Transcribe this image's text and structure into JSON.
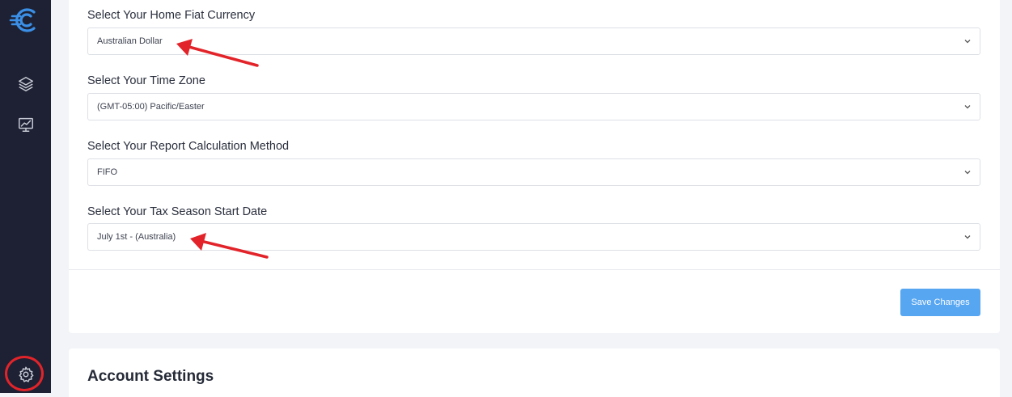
{
  "sidebar": {
    "icons": [
      "logo-icon",
      "layers-icon",
      "chart-icon",
      "gear-icon"
    ]
  },
  "settings": {
    "currency": {
      "label": "Select Your Home Fiat Currency",
      "value": "Australian Dollar"
    },
    "timezone": {
      "label": "Select Your Time Zone",
      "value": "(GMT-05:00) Pacific/Easter"
    },
    "method": {
      "label": "Select Your Report Calculation Method",
      "value": "FIFO"
    },
    "tax_start": {
      "label": "Select Your Tax Season Start Date",
      "value": "July 1st - (Australia)"
    },
    "save_label": "Save Changes"
  },
  "account": {
    "title": "Account Settings"
  },
  "colors": {
    "sidebar": "#1d2133",
    "accent": "#57a6f2",
    "annotation": "#e2242a",
    "logo": "#3b8fe6"
  }
}
